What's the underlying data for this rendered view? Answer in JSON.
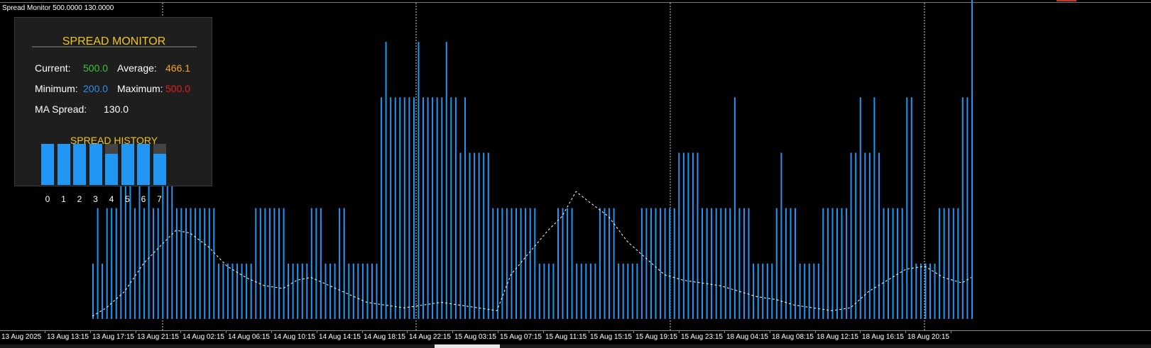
{
  "window": {
    "title": "Spread Monitor 500.0000 130.0000"
  },
  "colors": {
    "bar": "#2196f3",
    "ma_line": "#ffffff",
    "title_gold": "#f0c419",
    "current_green": "#3cc23c",
    "average_orange": "#f5a623",
    "minimum_blue": "#2e8fe8",
    "maximum_red": "#e02020",
    "background": "#000000"
  },
  "panel": {
    "title": "SPREAD MONITOR",
    "current_label": "Current:",
    "current_value": "500.0",
    "average_label": "Average:",
    "average_value": "466.1",
    "minimum_label": "Minimum:",
    "minimum_value": "200.0",
    "maximum_label": "Maximum:",
    "maximum_value": "500.0",
    "ma_label": "MA Spread:",
    "ma_value": "130.0",
    "history_title": "SPREAD HISTORY",
    "history": [
      {
        "label": "0",
        "value": 500
      },
      {
        "label": "1",
        "value": 500
      },
      {
        "label": "2",
        "value": 500
      },
      {
        "label": "3",
        "value": 500
      },
      {
        "label": "4",
        "value": 400
      },
      {
        "label": "5",
        "value": 500
      },
      {
        "label": "6",
        "value": 500
      },
      {
        "label": "7",
        "value": 400
      }
    ],
    "history_max": 500
  },
  "chart_data": {
    "type": "bar",
    "ylim": [
      0,
      550
    ],
    "x_tick_labels": [
      "13 Aug 2025",
      "13 Aug 13:15",
      "13 Aug 17:15",
      "13 Aug 21:15",
      "14 Aug 02:15",
      "14 Aug 06:15",
      "14 Aug 10:15",
      "14 Aug 14:15",
      "14 Aug 18:15",
      "14 Aug 22:15",
      "15 Aug 03:15",
      "15 Aug 07:15",
      "15 Aug 11:15",
      "15 Aug 15:15",
      "15 Aug 19:15",
      "15 Aug 23:15",
      "18 Aug 04:15",
      "18 Aug 08:15",
      "18 Aug 12:15",
      "18 Aug 16:15",
      "18 Aug 20:15"
    ],
    "bar_groups": [
      {
        "start": 1,
        "end": 3,
        "value": 100
      },
      {
        "start": 4,
        "end": 6,
        "value": 200
      },
      {
        "start": 7,
        "end": 9,
        "value": 300
      },
      {
        "start": 10,
        "end": 18,
        "value": 200
      },
      {
        "start": 19,
        "end": 23,
        "value": 200
      },
      {
        "start": 24,
        "end": 27,
        "value": 200
      },
      {
        "start": 28,
        "end": 29,
        "value": 100
      },
      {
        "start": 30,
        "end": 35,
        "value": 100
      },
      {
        "start": 36,
        "end": 38,
        "value": 200
      },
      {
        "start": 39,
        "end": 42,
        "value": 200
      },
      {
        "start": 43,
        "end": 47,
        "value": 100
      },
      {
        "start": 48,
        "end": 50,
        "value": 200
      },
      {
        "start": 51,
        "end": 53,
        "value": 100
      },
      {
        "start": 54,
        "end": 55,
        "value": 200
      },
      {
        "start": 56,
        "end": 62,
        "value": 100
      },
      {
        "start": 63,
        "end": 66,
        "value": 300
      },
      {
        "start": 67,
        "end": 70,
        "value": 400
      },
      {
        "start": 71,
        "end": 76,
        "value": 300
      },
      {
        "start": 77,
        "end": 81,
        "value": 400
      },
      {
        "start": 82,
        "end": 86,
        "value": 300
      },
      {
        "start": 87,
        "end": 90,
        "value": 200
      },
      {
        "start": 91,
        "end": 96,
        "value": 200
      },
      {
        "start": 97,
        "end": 100,
        "value": 100
      },
      {
        "start": 101,
        "end": 104,
        "value": 200
      },
      {
        "start": 105,
        "end": 109,
        "value": 100
      },
      {
        "start": 110,
        "end": 113,
        "value": 200
      },
      {
        "start": 114,
        "end": 118,
        "value": 100
      },
      {
        "start": 119,
        "end": 126,
        "value": 200
      },
      {
        "start": 127,
        "end": 131,
        "value": 300
      },
      {
        "start": 132,
        "end": 137,
        "value": 200
      },
      {
        "start": 138,
        "end": 142,
        "value": 200
      },
      {
        "start": 143,
        "end": 147,
        "value": 100
      },
      {
        "start": 148,
        "end": 152,
        "value": 200
      },
      {
        "start": 153,
        "end": 157,
        "value": 100
      },
      {
        "start": 158,
        "end": 163,
        "value": 200
      },
      {
        "start": 164,
        "end": 170,
        "value": 300
      },
      {
        "start": 171,
        "end": 175,
        "value": 200
      },
      {
        "start": 176,
        "end": 177,
        "value": 400
      },
      {
        "start": 178,
        "end": 182,
        "value": 100
      },
      {
        "start": 183,
        "end": 190,
        "value": 200
      }
    ],
    "bars": [
      {
        "i": 2,
        "value": 200
      },
      {
        "i": 9,
        "value": 500
      },
      {
        "i": 11,
        "value": 300
      },
      {
        "i": 13,
        "value": 300
      },
      {
        "i": 16,
        "value": 300
      },
      {
        "i": 17,
        "value": 300
      },
      {
        "i": 18,
        "value": 300
      },
      {
        "i": 63,
        "value": 400
      },
      {
        "i": 64,
        "value": 500
      },
      {
        "i": 65,
        "value": 400
      },
      {
        "i": 66,
        "value": 400
      },
      {
        "i": 67,
        "value": 400
      },
      {
        "i": 68,
        "value": 400
      },
      {
        "i": 69,
        "value": 400
      },
      {
        "i": 70,
        "value": 400
      },
      {
        "i": 71,
        "value": 500
      },
      {
        "i": 72,
        "value": 400
      },
      {
        "i": 73,
        "value": 400
      },
      {
        "i": 74,
        "value": 400
      },
      {
        "i": 75,
        "value": 400
      },
      {
        "i": 76,
        "value": 400
      },
      {
        "i": 77,
        "value": 500
      },
      {
        "i": 78,
        "value": 400
      },
      {
        "i": 79,
        "value": 400
      },
      {
        "i": 80,
        "value": 300
      },
      {
        "i": 81,
        "value": 400
      },
      {
        "i": 139,
        "value": 400
      },
      {
        "i": 149,
        "value": 300
      },
      {
        "i": 166,
        "value": 400
      },
      {
        "i": 169,
        "value": 400
      },
      {
        "i": 189,
        "value": 400
      },
      {
        "i": 190,
        "value": 600
      },
      {
        "i": 188,
        "value": 400
      }
    ],
    "ma": [
      [
        1,
        5
      ],
      [
        4,
        20
      ],
      [
        8,
        50
      ],
      [
        12,
        100
      ],
      [
        16,
        135
      ],
      [
        19,
        160
      ],
      [
        22,
        155
      ],
      [
        26,
        130
      ],
      [
        30,
        95
      ],
      [
        34,
        75
      ],
      [
        38,
        60
      ],
      [
        42,
        55
      ],
      [
        45,
        70
      ],
      [
        48,
        75
      ],
      [
        52,
        60
      ],
      [
        56,
        45
      ],
      [
        60,
        30
      ],
      [
        64,
        25
      ],
      [
        68,
        20
      ],
      [
        72,
        25
      ],
      [
        76,
        30
      ],
      [
        80,
        25
      ],
      [
        84,
        20
      ],
      [
        88,
        15
      ],
      [
        91,
        80
      ],
      [
        95,
        120
      ],
      [
        99,
        160
      ],
      [
        102,
        185
      ],
      [
        105,
        230
      ],
      [
        108,
        210
      ],
      [
        112,
        185
      ],
      [
        116,
        140
      ],
      [
        120,
        110
      ],
      [
        124,
        80
      ],
      [
        128,
        70
      ],
      [
        132,
        65
      ],
      [
        136,
        60
      ],
      [
        140,
        50
      ],
      [
        144,
        40
      ],
      [
        148,
        35
      ],
      [
        152,
        25
      ],
      [
        156,
        20
      ],
      [
        160,
        15
      ],
      [
        164,
        20
      ],
      [
        168,
        50
      ],
      [
        172,
        70
      ],
      [
        176,
        90
      ],
      [
        180,
        95
      ],
      [
        184,
        75
      ],
      [
        188,
        65
      ],
      [
        190,
        75
      ]
    ],
    "n_bars": 190
  }
}
